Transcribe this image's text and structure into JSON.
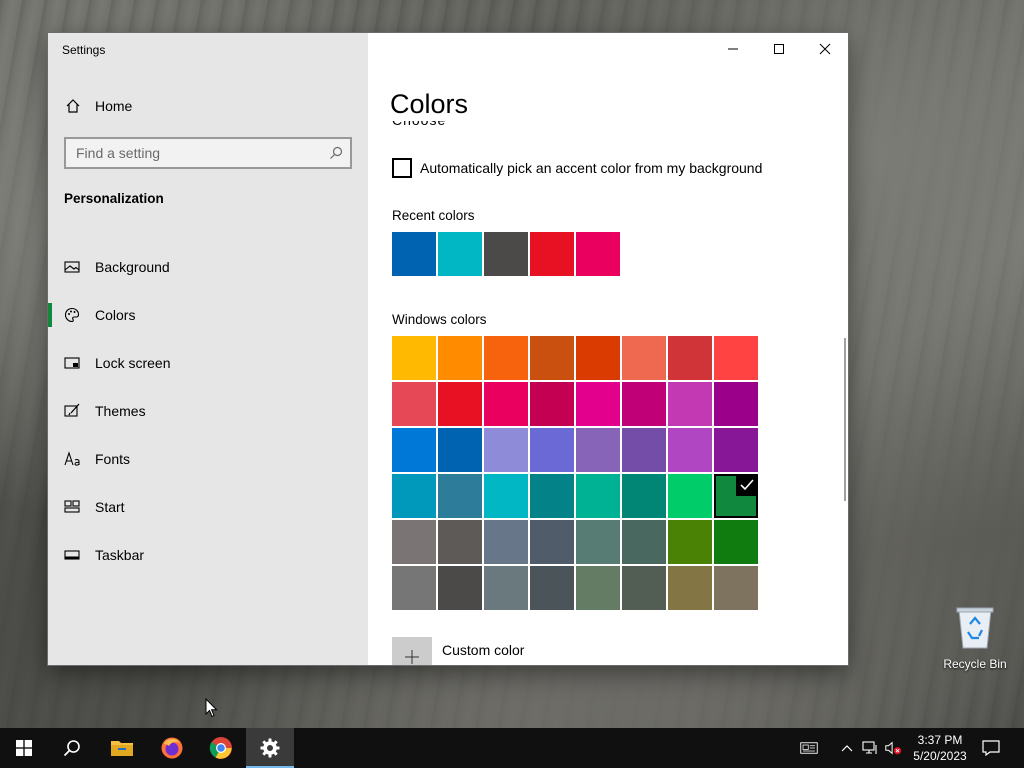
{
  "window": {
    "title": "Settings",
    "sidebar": {
      "home_label": "Home",
      "search_placeholder": "Find a setting",
      "section_heading": "Personalization",
      "items": [
        {
          "label": "Background",
          "icon": "image-icon"
        },
        {
          "label": "Colors",
          "icon": "palette-icon",
          "active": true
        },
        {
          "label": "Lock screen",
          "icon": "lock-screen-icon"
        },
        {
          "label": "Themes",
          "icon": "brush-icon"
        },
        {
          "label": "Fonts",
          "icon": "font-icon"
        },
        {
          "label": "Start",
          "icon": "start-icon"
        },
        {
          "label": "Taskbar",
          "icon": "taskbar-icon"
        }
      ]
    },
    "content": {
      "title": "Colors",
      "auto_accent_label": "Automatically pick an accent color from my background",
      "auto_accent_checked": false,
      "recent_label": "Recent colors",
      "recent_colors": [
        "#0063b1",
        "#00b7c3",
        "#4c4a48",
        "#e81123",
        "#ea005e"
      ],
      "windows_label": "Windows colors",
      "windows_colors": [
        "#ffb900",
        "#ff8c00",
        "#f7630c",
        "#ca5010",
        "#da3b01",
        "#ef6950",
        "#d13438",
        "#ff4343",
        "#e74856",
        "#e81123",
        "#ea005e",
        "#c30052",
        "#e3008c",
        "#bf0077",
        "#c239b3",
        "#9a0089",
        "#0078d7",
        "#0063b1",
        "#8e8cd8",
        "#6b69d6",
        "#8764b8",
        "#744da9",
        "#b146c2",
        "#881798",
        "#0099bc",
        "#2d7d9a",
        "#00b7c3",
        "#038387",
        "#00b294",
        "#018574",
        "#00cc6a",
        "#10893e",
        "#7a7574",
        "#5d5a58",
        "#68768a",
        "#515c6b",
        "#567c73",
        "#486860",
        "#498205",
        "#107c10",
        "#767676",
        "#4c4a48",
        "#69797e",
        "#4a5459",
        "#647c64",
        "#525e54",
        "#847545",
        "#7e735f"
      ],
      "selected_color": "#10893e",
      "custom_color_label": "Custom color"
    }
  },
  "desktop": {
    "recycle_bin_label": "Recycle Bin"
  },
  "taskbar": {
    "time": "3:37 PM",
    "date": "5/20/2023",
    "apps": [
      "start",
      "search",
      "file-explorer",
      "firefox",
      "chrome",
      "settings"
    ],
    "active_app": "settings"
  }
}
